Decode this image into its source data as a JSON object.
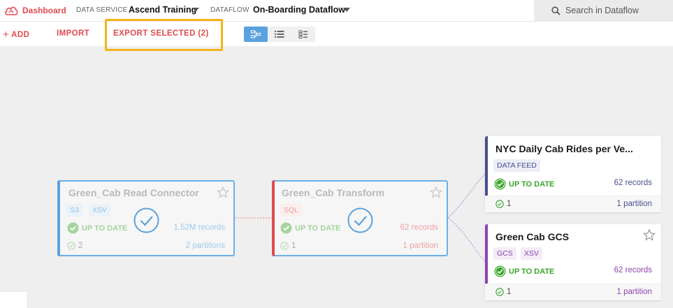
{
  "topbar": {
    "logo_label": "Dashboard",
    "data_service_label": "DATA SERVICE",
    "data_service_value": "Ascend Training",
    "dataflow_label": "DATAFLOW",
    "dataflow_value": "On-Boarding Dataflow",
    "search_placeholder": "Search in Dataflow"
  },
  "toolbar": {
    "add_label": "ADD",
    "import_label": "IMPORT",
    "export_label": "EXPORT SELECTED (2)",
    "highlight_color": "#f4b31a",
    "view_modes": [
      "graph-view",
      "list-view",
      "compact-view"
    ],
    "active_view": "graph-view"
  },
  "colors": {
    "accent_red": "#e04a4f",
    "blue": "#5aa2dd",
    "green": "#3aa62c",
    "navy": "#4a4e8f",
    "purple": "#8e44ad"
  },
  "nodes": {
    "read_connector": {
      "title": "Green_Cab Read Connector",
      "tags": [
        "S3",
        "XSV"
      ],
      "status": "UP TO DATE",
      "records": "1.52M records",
      "checks": "2",
      "partitions": "2 partitions",
      "selected": true
    },
    "transform": {
      "title": "Green_Cab Transform",
      "tags": [
        "SQL"
      ],
      "status": "UP TO DATE",
      "records": "62 records",
      "checks": "1",
      "partitions": "1 partition",
      "selected": true
    },
    "data_feed": {
      "title": "NYC Daily Cab Rides per Ve...",
      "tags": [
        "DATA FEED"
      ],
      "status": "UP TO DATE",
      "records": "62 records",
      "checks": "1",
      "partitions": "1 partition"
    },
    "gcs": {
      "title": "Green Cab GCS",
      "tags": [
        "GCS",
        "XSV"
      ],
      "status": "UP TO DATE",
      "records": "62 records",
      "checks": "1",
      "partitions": "1 partition"
    }
  }
}
